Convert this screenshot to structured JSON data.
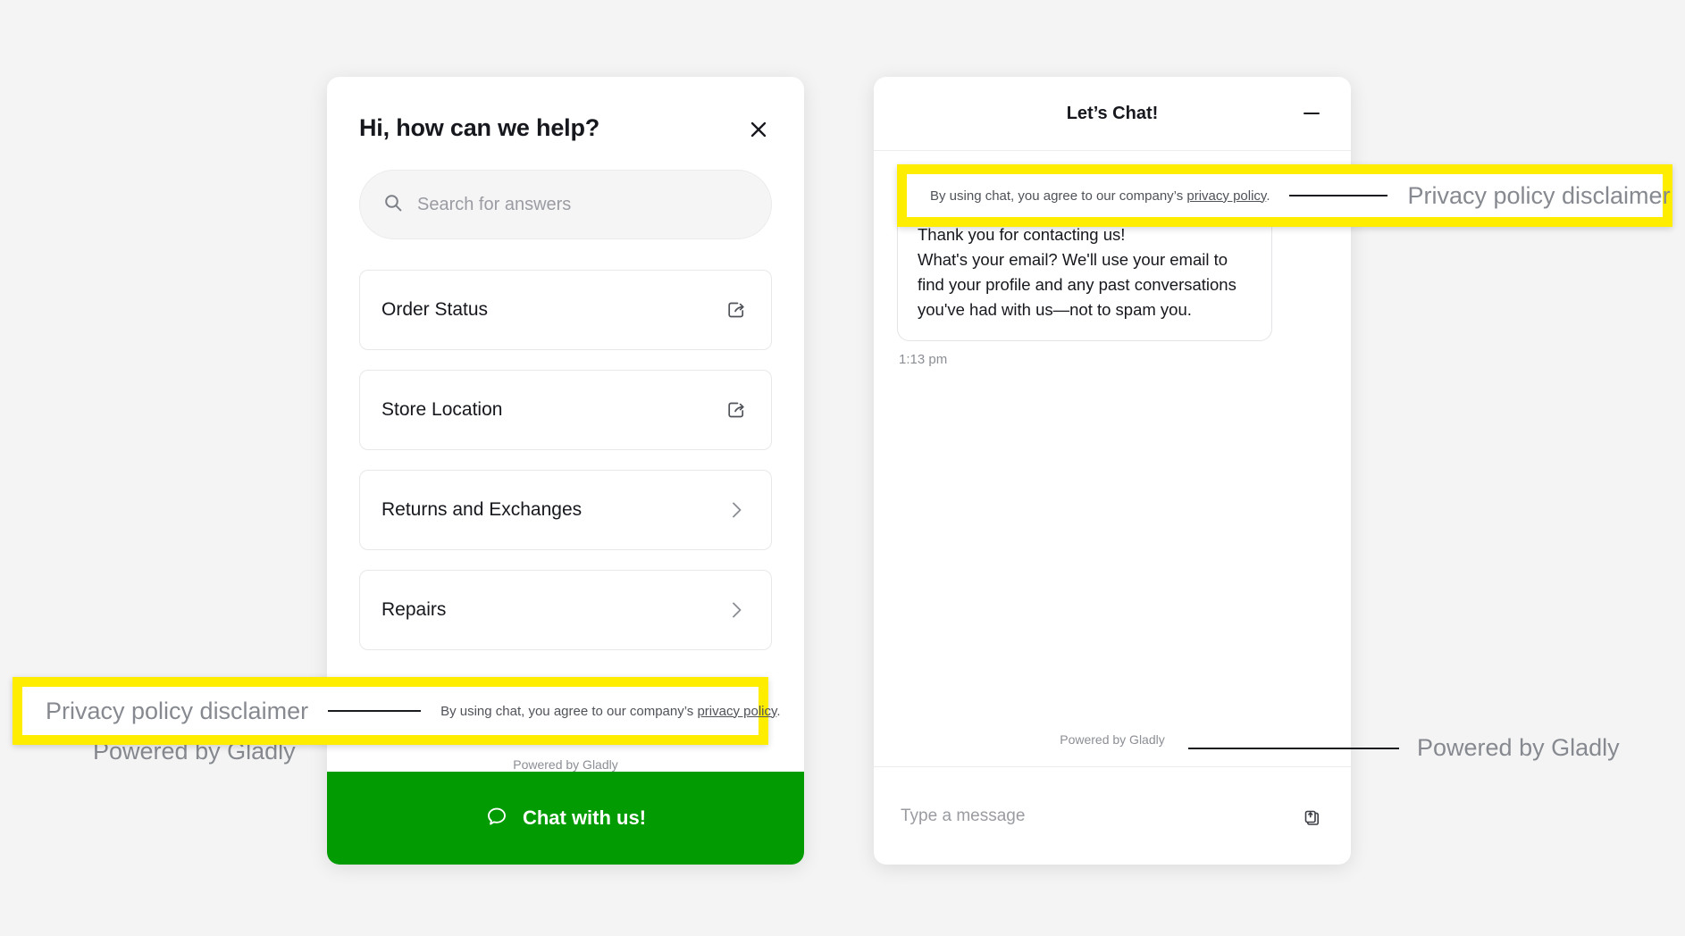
{
  "colors": {
    "page_background": "#f4f4f4",
    "cta_green": "#029b02",
    "annotation_yellow": "#ffed00",
    "annotation_label_gray": "#86898f"
  },
  "help_panel": {
    "title": "Hi, how can we help?",
    "close_icon": "close-icon",
    "search": {
      "icon": "search-icon",
      "placeholder": "Search for answers",
      "value": ""
    },
    "topics": [
      {
        "label": "Order Status",
        "icon": "external-link-icon"
      },
      {
        "label": "Store Location",
        "icon": "external-link-icon"
      },
      {
        "label": "Returns and Exchanges",
        "icon": "chevron-right-icon"
      },
      {
        "label": "Repairs",
        "icon": "chevron-right-icon"
      }
    ],
    "disclaimer_prefix": "By using chat, you agree to our company’s ",
    "disclaimer_link": "privacy policy",
    "disclaimer_suffix": ".",
    "powered_by": "Powered by Gladly",
    "cta": {
      "label": "Chat with us!",
      "icon": "chat-bubble-icon"
    }
  },
  "chat_panel": {
    "title": "Let’s Chat!",
    "minimize_icon": "minimize-icon",
    "disclaimer_prefix": "By using chat, you agree to our company’s ",
    "disclaimer_link": "privacy policy",
    "disclaimer_suffix": ".",
    "message": "Thank you for contacting us!\nWhat's your email? We'll use your email to find your profile and any past conversations you've had with us—not to spam you.",
    "message_time": "1:13 pm",
    "powered_by": "Powered by Gladly",
    "input": {
      "placeholder": "Type a message",
      "value": "",
      "attach_icon": "attachment-upload-icon"
    }
  },
  "annotations": {
    "privacy_left": {
      "label": "Privacy policy disclaimer",
      "target_prefix": "By using chat, you agree to our company’s ",
      "target_link": "privacy policy",
      "target_suffix": "."
    },
    "privacy_right": {
      "label": "Privacy policy disclaimer",
      "target_prefix": "By using chat, you agree to our company’s ",
      "target_link": "privacy policy",
      "target_suffix": "."
    },
    "powered_by_left_ghost": "Powered by Gladly",
    "powered_by_right": {
      "label": "Powered by Gladly",
      "target": "Powered by Gladly"
    }
  }
}
